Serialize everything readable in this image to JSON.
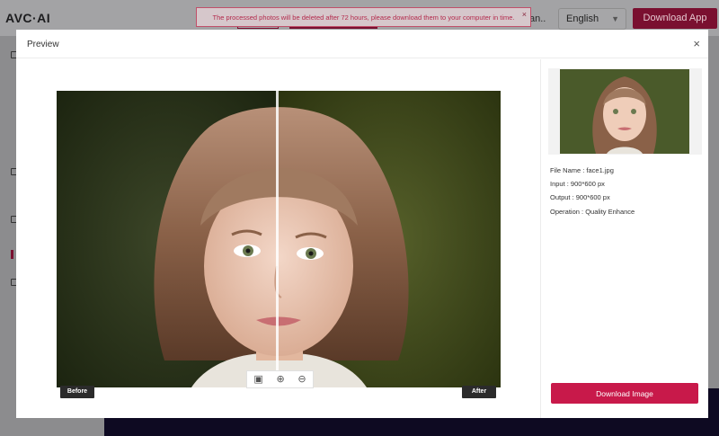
{
  "app": {
    "logo": "AVC·AI",
    "language_fragment": "an..",
    "language": "English",
    "download_app_label": "Download App"
  },
  "toast": {
    "message": "The processed photos will be deleted after 72 hours, please download them to your computer in time.",
    "close_label": "×"
  },
  "modal": {
    "title": "Preview",
    "close_label": "×",
    "before_label": "Before",
    "after_label": "After",
    "zoom_controls": {
      "fit_icon": "fit-screen-icon",
      "zoom_in_icon": "zoom-in-icon",
      "zoom_out_icon": "zoom-out-icon"
    },
    "info": {
      "file_name": "File Name : face1.jpg",
      "input": "Input : 900*600 px",
      "output": "Output : 900*600 px",
      "operation": "Operation : Quality Enhance"
    },
    "download_label": "Download Image"
  },
  "colors": {
    "accent": "#c8194a",
    "overlay": "#8c8c8e",
    "footer_dark": "#0e0a22"
  }
}
